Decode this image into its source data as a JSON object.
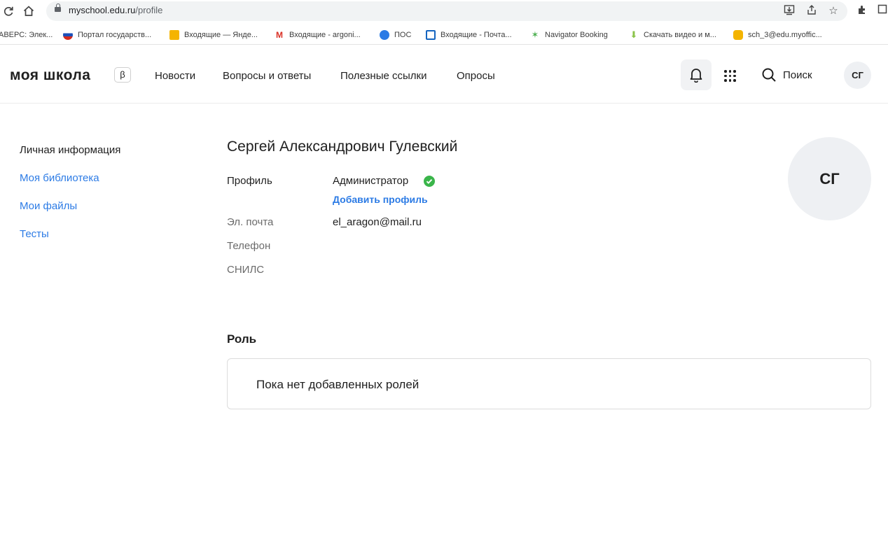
{
  "browser": {
    "url_host": "myschool.edu.ru",
    "url_path": "/profile"
  },
  "bookmarks": [
    {
      "label": "АВЕРС: Элек...",
      "color": ""
    },
    {
      "label": "Портал государств...",
      "color": "#1c4fb8"
    },
    {
      "label": "Входящие — Янде...",
      "color": "#f5b400"
    },
    {
      "label": "Входящие - argoni...",
      "color": "#d93025"
    },
    {
      "label": "ПОС",
      "color": "#2c7be5"
    },
    {
      "label": "Входящие - Почта...",
      "color": "#1565c0"
    },
    {
      "label": "Navigator Booking",
      "color": "#4caf50"
    },
    {
      "label": "Скачать видео и м...",
      "color": "#8bc34a"
    },
    {
      "label": "sch_3@edu.myoffic...",
      "color": "#f4b400"
    }
  ],
  "header": {
    "logo": "моя школа",
    "beta": "β",
    "nav": [
      "Новости",
      "Вопросы и ответы",
      "Полезные ссылки",
      "Опросы"
    ],
    "search_label": "Поиск",
    "avatar_initials": "СГ"
  },
  "sidebar": {
    "items": [
      {
        "label": "Личная информация",
        "active": true
      },
      {
        "label": "Моя библиотека",
        "active": false
      },
      {
        "label": "Мои файлы",
        "active": false
      },
      {
        "label": "Тесты",
        "active": false
      }
    ]
  },
  "profile": {
    "full_name": "Сергей Александрович Гулевский",
    "profile_label": "Профиль",
    "profile_value": "Администратор",
    "add_profile": "Добавить профиль",
    "email_label": "Эл. почта",
    "email_value": "el_aragon@mail.ru",
    "phone_label": "Телефон",
    "snils_label": "СНИЛС",
    "avatar_initials": "СГ"
  },
  "roles": {
    "title": "Роль",
    "empty_text": "Пока нет добавленных ролей"
  },
  "colors": {
    "accent": "#2c7be5",
    "verified": "#3ab54a"
  }
}
